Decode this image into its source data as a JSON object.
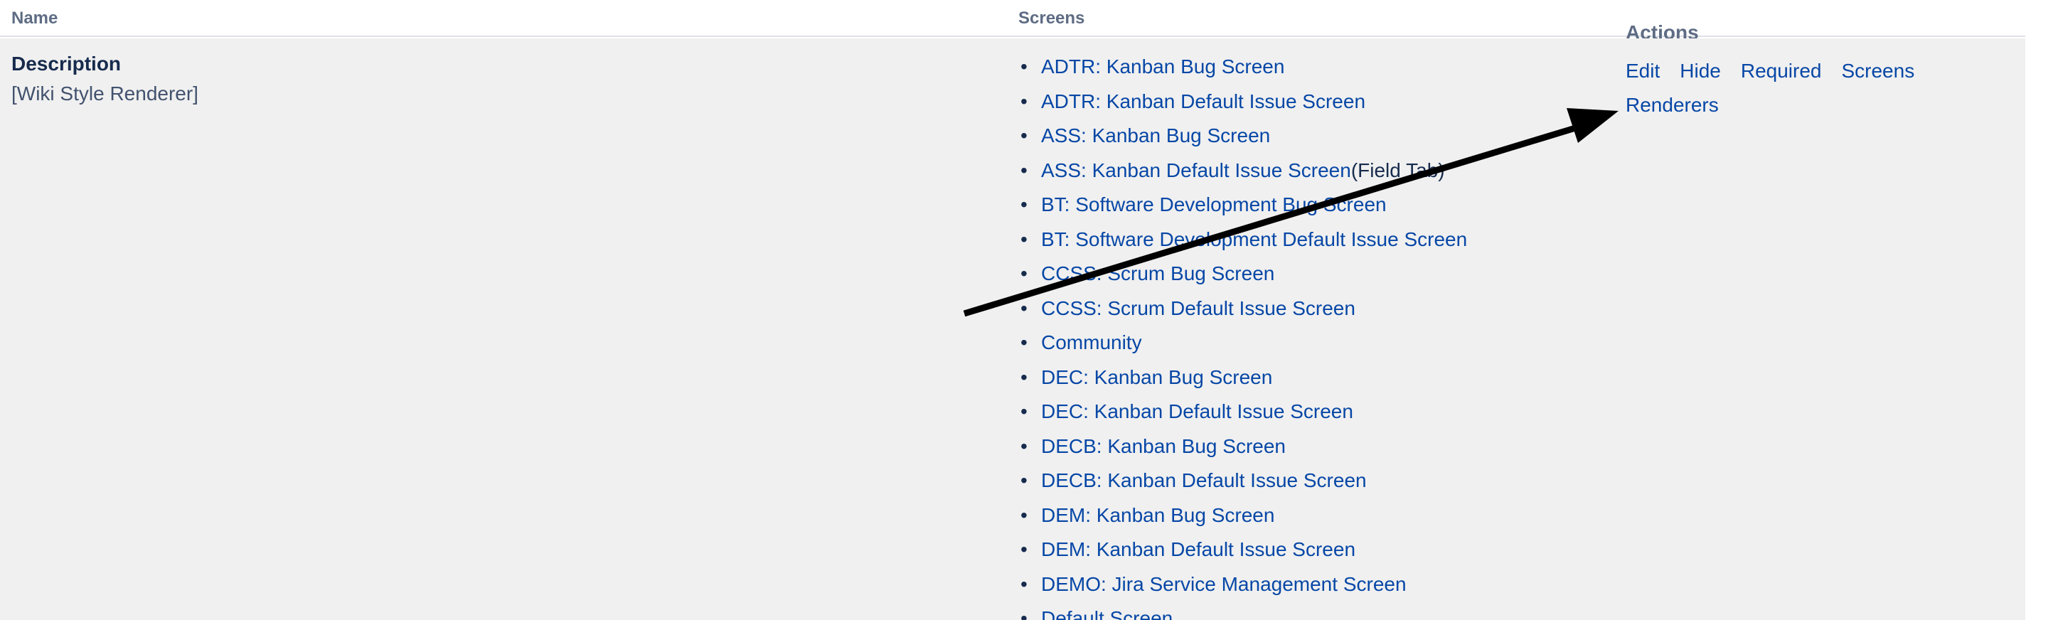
{
  "table": {
    "headers": {
      "name": "Name",
      "screens": "Screens",
      "actions": "Actions"
    }
  },
  "field": {
    "name": "Description",
    "renderer": "[Wiki Style Renderer]"
  },
  "screens": [
    {
      "label": "ADTR: Kanban Bug Screen",
      "tab": ""
    },
    {
      "label": "ADTR: Kanban Default Issue Screen",
      "tab": ""
    },
    {
      "label": "ASS: Kanban Bug Screen",
      "tab": ""
    },
    {
      "label": "ASS: Kanban Default Issue Screen",
      "tab": "(Field Tab)"
    },
    {
      "label": "BT: Software Development Bug Screen",
      "tab": ""
    },
    {
      "label": "BT: Software Development Default Issue Screen",
      "tab": ""
    },
    {
      "label": "CCSS: Scrum Bug Screen",
      "tab": ""
    },
    {
      "label": "CCSS: Scrum Default Issue Screen",
      "tab": ""
    },
    {
      "label": "Community",
      "tab": ""
    },
    {
      "label": "DEC: Kanban Bug Screen",
      "tab": ""
    },
    {
      "label": "DEC: Kanban Default Issue Screen",
      "tab": ""
    },
    {
      "label": "DECB: Kanban Bug Screen",
      "tab": ""
    },
    {
      "label": "DECB: Kanban Default Issue Screen",
      "tab": ""
    },
    {
      "label": "DEM: Kanban Bug Screen",
      "tab": ""
    },
    {
      "label": "DEM: Kanban Default Issue Screen",
      "tab": ""
    },
    {
      "label": "DEMO: Jira Service Management Screen",
      "tab": ""
    },
    {
      "label": "Default Screen",
      "tab": ""
    }
  ],
  "actions": {
    "edit": "Edit",
    "hide": "Hide",
    "required": "Required",
    "screens": "Screens",
    "renderers": "Renderers"
  },
  "colors": {
    "link": "#0747a6",
    "row_background": "#f0f0f0",
    "header_text": "#5e6c84",
    "arrow": "#000000"
  }
}
